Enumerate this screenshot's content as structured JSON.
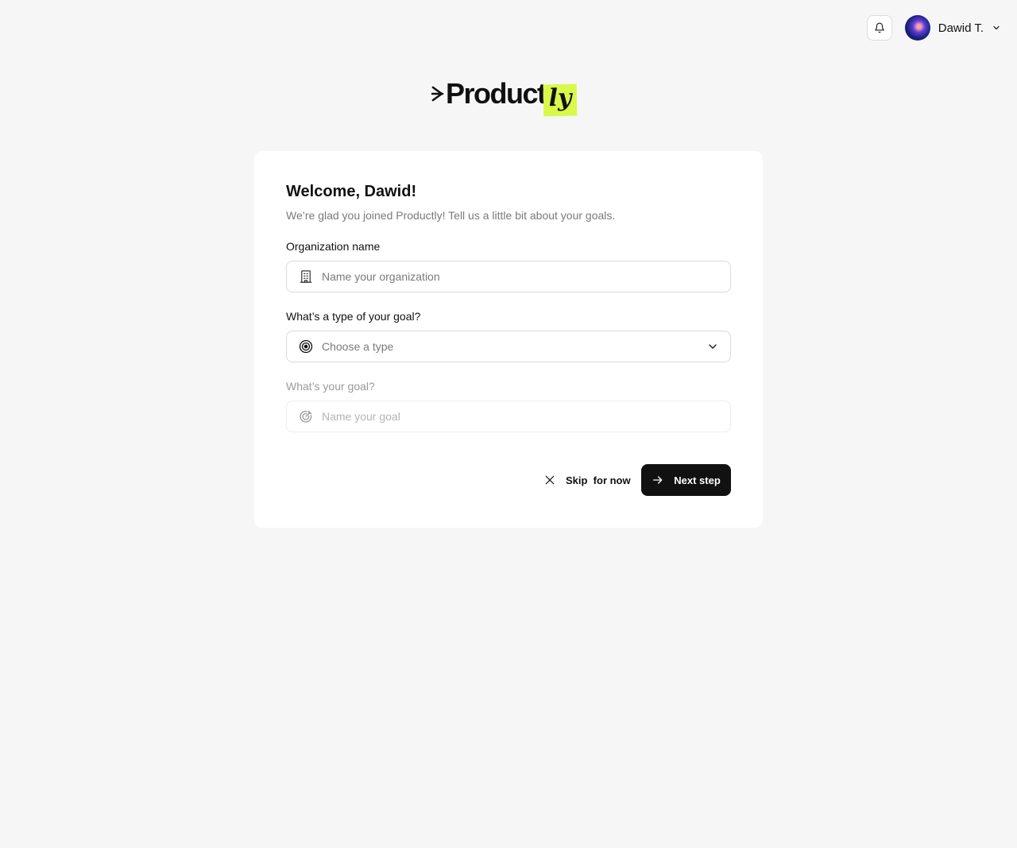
{
  "header": {
    "notifications_icon": "bell-icon",
    "user_name": "Dawid T.",
    "user_menu_icon": "chevron-down-icon"
  },
  "logo": {
    "text": "Product",
    "suffix": "ly",
    "suffix_bg": "#d9f94a"
  },
  "form": {
    "title": "Welcome, Dawid!",
    "subtitle": "We’re glad you joined Productly! Tell us a little bit about your goals.",
    "org": {
      "label": "Organization name",
      "placeholder": "Name your organization",
      "icon": "building-icon"
    },
    "goal_type": {
      "label": "What’s a type of your goal?",
      "value": "Choose a type",
      "icon": "target-icon"
    },
    "goal": {
      "label": "What’s your goal?",
      "placeholder": "Name your goal",
      "icon": "goal-icon",
      "disabled": true
    },
    "skip_label": "Skip  for now",
    "next_label": "Next step"
  },
  "colors": {
    "background": "#f6f6f6",
    "primary_button": "#111111",
    "accent": "#d9f94a"
  }
}
